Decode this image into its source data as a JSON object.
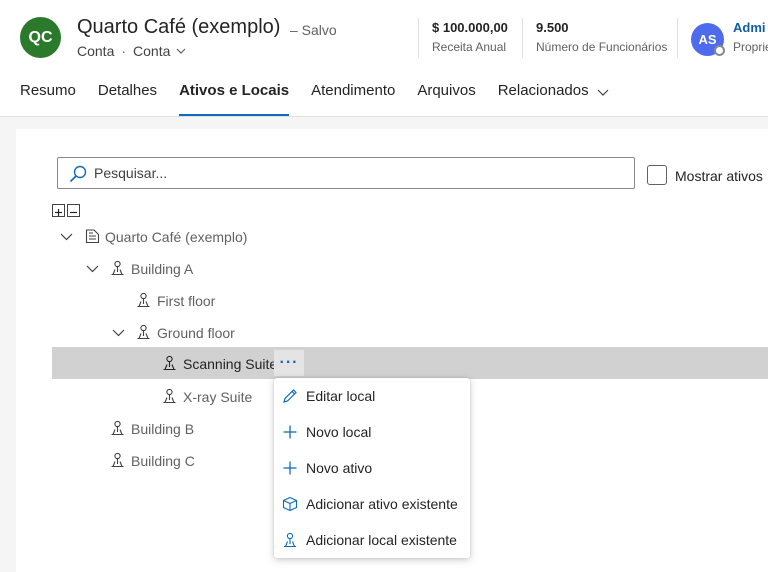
{
  "record": {
    "initials": "QC",
    "title": "Quarto Café (exemplo)",
    "saved": "– Salvo",
    "entity": "Conta",
    "form": "Conta"
  },
  "kpis": [
    {
      "value": "$ 100.000,00",
      "label": "Receita Anual"
    },
    {
      "value": "9.500",
      "label": "Número de Funcionários"
    }
  ],
  "owner": {
    "initials": "AS",
    "name": "Admi",
    "role": "Proprie"
  },
  "tabs": [
    "Resumo",
    "Detalhes",
    "Ativos e Locais",
    "Atendimento",
    "Arquivos",
    "Relacionados"
  ],
  "active_tab": "Ativos e Locais",
  "search": {
    "placeholder": "Pesquisar...",
    "value": ""
  },
  "show_assets_label": "Mostrar ativos",
  "tree": [
    {
      "label": "Quarto Café (exemplo)",
      "level": 0,
      "expanded": true,
      "type": "account"
    },
    {
      "label": "Building A",
      "level": 1,
      "expanded": true,
      "type": "location"
    },
    {
      "label": "First floor",
      "level": 2,
      "expanded": false,
      "type": "location"
    },
    {
      "label": "Ground floor",
      "level": 2,
      "expanded": true,
      "type": "location"
    },
    {
      "label": "Scanning Suite",
      "level": 3,
      "expanded": false,
      "type": "location",
      "selected": true
    },
    {
      "label": "X-ray Suite",
      "level": 3,
      "expanded": false,
      "type": "location"
    },
    {
      "label": "Building B",
      "level": 1,
      "expanded": false,
      "type": "location"
    },
    {
      "label": "Building C",
      "level": 1,
      "expanded": false,
      "type": "location"
    }
  ],
  "more_label": "···",
  "context_menu": [
    {
      "label": "Editar local",
      "icon": "pencil-icon"
    },
    {
      "label": "Novo local",
      "icon": "plus-icon"
    },
    {
      "label": "Novo ativo",
      "icon": "plus-icon"
    },
    {
      "label": "Adicionar ativo existente",
      "icon": "cube-icon"
    },
    {
      "label": "Adicionar local existente",
      "icon": "location-icon"
    }
  ],
  "colors": {
    "accent": "#0f6cbd",
    "avatar_record": "#2b7a2b",
    "avatar_owner": "#4f6bed",
    "selected_row": "#d1d1d1"
  }
}
